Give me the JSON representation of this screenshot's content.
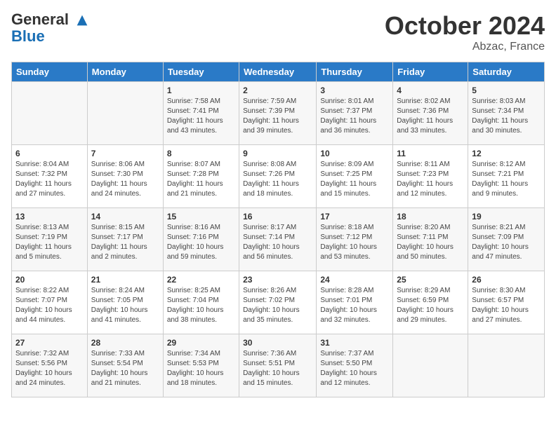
{
  "header": {
    "logo_line1": "General",
    "logo_line2": "Blue",
    "month": "October 2024",
    "location": "Abzac, France"
  },
  "columns": [
    "Sunday",
    "Monday",
    "Tuesday",
    "Wednesday",
    "Thursday",
    "Friday",
    "Saturday"
  ],
  "weeks": [
    [
      {
        "day": "",
        "sunrise": "",
        "sunset": "",
        "daylight": ""
      },
      {
        "day": "",
        "sunrise": "",
        "sunset": "",
        "daylight": ""
      },
      {
        "day": "1",
        "sunrise": "Sunrise: 7:58 AM",
        "sunset": "Sunset: 7:41 PM",
        "daylight": "Daylight: 11 hours and 43 minutes."
      },
      {
        "day": "2",
        "sunrise": "Sunrise: 7:59 AM",
        "sunset": "Sunset: 7:39 PM",
        "daylight": "Daylight: 11 hours and 39 minutes."
      },
      {
        "day": "3",
        "sunrise": "Sunrise: 8:01 AM",
        "sunset": "Sunset: 7:37 PM",
        "daylight": "Daylight: 11 hours and 36 minutes."
      },
      {
        "day": "4",
        "sunrise": "Sunrise: 8:02 AM",
        "sunset": "Sunset: 7:36 PM",
        "daylight": "Daylight: 11 hours and 33 minutes."
      },
      {
        "day": "5",
        "sunrise": "Sunrise: 8:03 AM",
        "sunset": "Sunset: 7:34 PM",
        "daylight": "Daylight: 11 hours and 30 minutes."
      }
    ],
    [
      {
        "day": "6",
        "sunrise": "Sunrise: 8:04 AM",
        "sunset": "Sunset: 7:32 PM",
        "daylight": "Daylight: 11 hours and 27 minutes."
      },
      {
        "day": "7",
        "sunrise": "Sunrise: 8:06 AM",
        "sunset": "Sunset: 7:30 PM",
        "daylight": "Daylight: 11 hours and 24 minutes."
      },
      {
        "day": "8",
        "sunrise": "Sunrise: 8:07 AM",
        "sunset": "Sunset: 7:28 PM",
        "daylight": "Daylight: 11 hours and 21 minutes."
      },
      {
        "day": "9",
        "sunrise": "Sunrise: 8:08 AM",
        "sunset": "Sunset: 7:26 PM",
        "daylight": "Daylight: 11 hours and 18 minutes."
      },
      {
        "day": "10",
        "sunrise": "Sunrise: 8:09 AM",
        "sunset": "Sunset: 7:25 PM",
        "daylight": "Daylight: 11 hours and 15 minutes."
      },
      {
        "day": "11",
        "sunrise": "Sunrise: 8:11 AM",
        "sunset": "Sunset: 7:23 PM",
        "daylight": "Daylight: 11 hours and 12 minutes."
      },
      {
        "day": "12",
        "sunrise": "Sunrise: 8:12 AM",
        "sunset": "Sunset: 7:21 PM",
        "daylight": "Daylight: 11 hours and 9 minutes."
      }
    ],
    [
      {
        "day": "13",
        "sunrise": "Sunrise: 8:13 AM",
        "sunset": "Sunset: 7:19 PM",
        "daylight": "Daylight: 11 hours and 5 minutes."
      },
      {
        "day": "14",
        "sunrise": "Sunrise: 8:15 AM",
        "sunset": "Sunset: 7:17 PM",
        "daylight": "Daylight: 11 hours and 2 minutes."
      },
      {
        "day": "15",
        "sunrise": "Sunrise: 8:16 AM",
        "sunset": "Sunset: 7:16 PM",
        "daylight": "Daylight: 10 hours and 59 minutes."
      },
      {
        "day": "16",
        "sunrise": "Sunrise: 8:17 AM",
        "sunset": "Sunset: 7:14 PM",
        "daylight": "Daylight: 10 hours and 56 minutes."
      },
      {
        "day": "17",
        "sunrise": "Sunrise: 8:18 AM",
        "sunset": "Sunset: 7:12 PM",
        "daylight": "Daylight: 10 hours and 53 minutes."
      },
      {
        "day": "18",
        "sunrise": "Sunrise: 8:20 AM",
        "sunset": "Sunset: 7:11 PM",
        "daylight": "Daylight: 10 hours and 50 minutes."
      },
      {
        "day": "19",
        "sunrise": "Sunrise: 8:21 AM",
        "sunset": "Sunset: 7:09 PM",
        "daylight": "Daylight: 10 hours and 47 minutes."
      }
    ],
    [
      {
        "day": "20",
        "sunrise": "Sunrise: 8:22 AM",
        "sunset": "Sunset: 7:07 PM",
        "daylight": "Daylight: 10 hours and 44 minutes."
      },
      {
        "day": "21",
        "sunrise": "Sunrise: 8:24 AM",
        "sunset": "Sunset: 7:05 PM",
        "daylight": "Daylight: 10 hours and 41 minutes."
      },
      {
        "day": "22",
        "sunrise": "Sunrise: 8:25 AM",
        "sunset": "Sunset: 7:04 PM",
        "daylight": "Daylight: 10 hours and 38 minutes."
      },
      {
        "day": "23",
        "sunrise": "Sunrise: 8:26 AM",
        "sunset": "Sunset: 7:02 PM",
        "daylight": "Daylight: 10 hours and 35 minutes."
      },
      {
        "day": "24",
        "sunrise": "Sunrise: 8:28 AM",
        "sunset": "Sunset: 7:01 PM",
        "daylight": "Daylight: 10 hours and 32 minutes."
      },
      {
        "day": "25",
        "sunrise": "Sunrise: 8:29 AM",
        "sunset": "Sunset: 6:59 PM",
        "daylight": "Daylight: 10 hours and 29 minutes."
      },
      {
        "day": "26",
        "sunrise": "Sunrise: 8:30 AM",
        "sunset": "Sunset: 6:57 PM",
        "daylight": "Daylight: 10 hours and 27 minutes."
      }
    ],
    [
      {
        "day": "27",
        "sunrise": "Sunrise: 7:32 AM",
        "sunset": "Sunset: 5:56 PM",
        "daylight": "Daylight: 10 hours and 24 minutes."
      },
      {
        "day": "28",
        "sunrise": "Sunrise: 7:33 AM",
        "sunset": "Sunset: 5:54 PM",
        "daylight": "Daylight: 10 hours and 21 minutes."
      },
      {
        "day": "29",
        "sunrise": "Sunrise: 7:34 AM",
        "sunset": "Sunset: 5:53 PM",
        "daylight": "Daylight: 10 hours and 18 minutes."
      },
      {
        "day": "30",
        "sunrise": "Sunrise: 7:36 AM",
        "sunset": "Sunset: 5:51 PM",
        "daylight": "Daylight: 10 hours and 15 minutes."
      },
      {
        "day": "31",
        "sunrise": "Sunrise: 7:37 AM",
        "sunset": "Sunset: 5:50 PM",
        "daylight": "Daylight: 10 hours and 12 minutes."
      },
      {
        "day": "",
        "sunrise": "",
        "sunset": "",
        "daylight": ""
      },
      {
        "day": "",
        "sunrise": "",
        "sunset": "",
        "daylight": ""
      }
    ]
  ]
}
